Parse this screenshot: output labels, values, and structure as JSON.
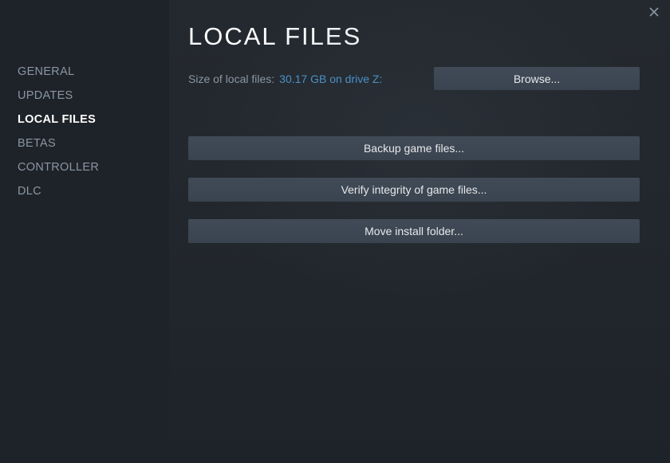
{
  "sidebar": {
    "items": [
      {
        "label": "GENERAL"
      },
      {
        "label": "UPDATES"
      },
      {
        "label": "LOCAL FILES"
      },
      {
        "label": "BETAS"
      },
      {
        "label": "CONTROLLER"
      },
      {
        "label": "DLC"
      }
    ]
  },
  "header": {
    "title": "LOCAL FILES"
  },
  "info": {
    "size_label": "Size of local files:",
    "size_value": "30.17 GB on drive Z:",
    "browse_label": "Browse..."
  },
  "actions": {
    "backup_label": "Backup game files...",
    "verify_label": "Verify integrity of game files...",
    "move_label": "Move install folder..."
  }
}
